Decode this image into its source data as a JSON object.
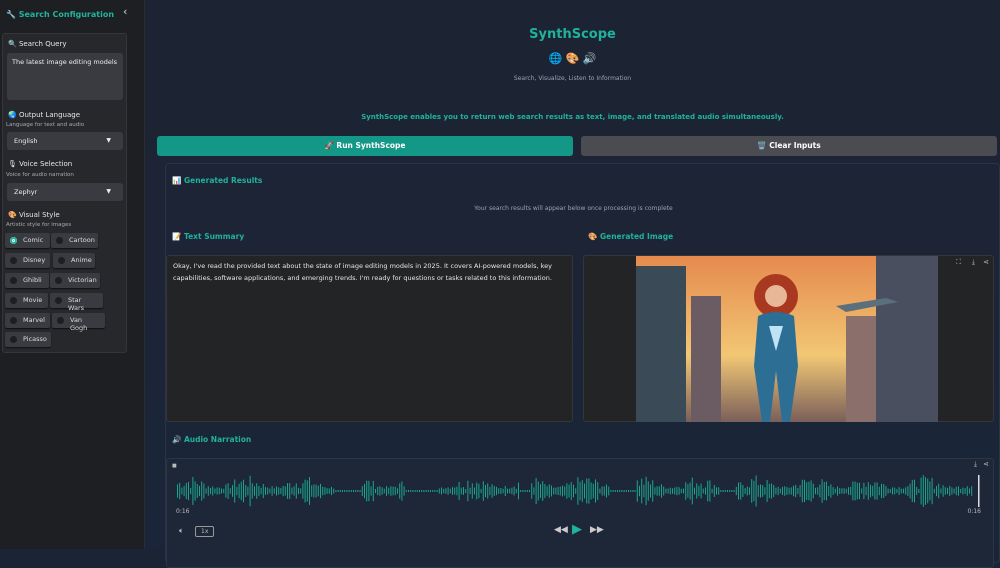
{
  "sidebar": {
    "title": "🔧 Search Configuration",
    "collapse": "‹",
    "query_label": "🔍 Search Query",
    "query_value": "The latest image editing models",
    "language_label": "🌏 Output Language",
    "language_sub": "Language for text and audio",
    "language_value": "English",
    "voice_label": "🎙 Voice Selection",
    "voice_sub": "Voice for audio narration",
    "voice_value": "Zephyr",
    "style_label": "🎨 Visual Style",
    "style_sub": "Artistic style for images",
    "styles": [
      "Comic",
      "Cartoon",
      "Disney",
      "Anime",
      "Ghibli",
      "Victorian",
      "Movie",
      "Star Wars",
      "Marvel",
      "Van Gogh",
      "Picasso"
    ],
    "selected_style": "Comic"
  },
  "header": {
    "title": "SynthScope",
    "icons": "🌐 🎨 🔊",
    "tagline": "Search, Visualize, Listen to Information",
    "description": "SynthScope enables you to return web search results as text, image, and translated audio simultaneously."
  },
  "buttons": {
    "run": "🚀 Run SynthScope",
    "clear": "🗑️ Clear Inputs"
  },
  "results": {
    "heading": "📊 Generated Results",
    "placeholder": "Your search results will appear below once processing is complete",
    "text_heading": "📝 Text Summary",
    "text": "Okay, I've read the provided text about the state of image editing models in 2025. It covers AI-powered models, key capabilities, software applications, and emerging trends. I'm ready for questions or tasks related to this information.",
    "image_heading": "🎨 Generated Image",
    "audio_heading": "🔊 Audio Narration",
    "time_current": "0:16",
    "time_total": "0:16",
    "speed": "1x"
  },
  "colors": {
    "accent": "#20b29c"
  }
}
